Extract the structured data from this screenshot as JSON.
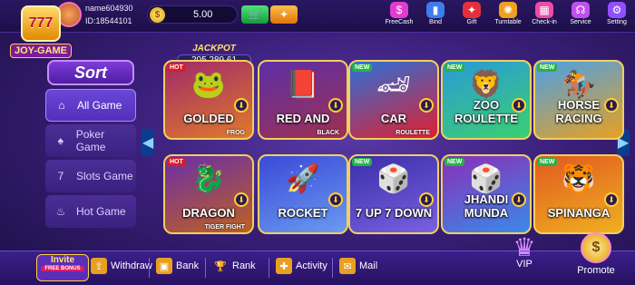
{
  "logo": {
    "badge": "777",
    "text": "JOY-GAME"
  },
  "user": {
    "name": "name604930",
    "id": "ID:18544101"
  },
  "balance": {
    "amount": "5.00"
  },
  "top_nav": [
    {
      "label": "FreeCash",
      "icon": "cash-icon",
      "color": "#e23bd0",
      "glyph": "$"
    },
    {
      "label": "Bind",
      "icon": "phone-icon",
      "color": "#3a7ef0",
      "glyph": "▮"
    },
    {
      "label": "Gift",
      "icon": "gift-icon",
      "color": "#e2313b",
      "glyph": "✦"
    },
    {
      "label": "Turntable",
      "icon": "wheel-icon",
      "color": "#f0a020",
      "glyph": "✺"
    },
    {
      "label": "Check-in",
      "icon": "calendar-icon",
      "color": "#ef4aa8",
      "glyph": "▦"
    },
    {
      "label": "Service",
      "icon": "headset-icon",
      "color": "#c050ee",
      "glyph": "☊"
    },
    {
      "label": "Setting",
      "icon": "gear-icon",
      "color": "#9050ff",
      "glyph": "⚙"
    }
  ],
  "sort_label": "Sort",
  "categories": [
    {
      "label": "All Game",
      "glyph": "⌂",
      "icon": "home-icon"
    },
    {
      "label": "Poker Game",
      "glyph": "♠",
      "icon": "poker-icon"
    },
    {
      "label": "Slots Game",
      "glyph": "7",
      "icon": "slots-icon"
    },
    {
      "label": "Hot Game",
      "glyph": "♨",
      "icon": "hot-icon"
    }
  ],
  "jackpot": {
    "title": "JACKPOT",
    "value": "205,289.61"
  },
  "games": [
    {
      "name": "GOLDED",
      "sub": "FROG",
      "tag": "HOT",
      "glyph": "🐸",
      "bg": "#a02a6a",
      "bg2": "#e07a2a"
    },
    {
      "name": "RED AND",
      "sub": "BLACK",
      "tag": "",
      "glyph": "📕",
      "bg": "#5b2fa8",
      "bg2": "#a03050"
    },
    {
      "name": "CAR",
      "sub": "ROULETTE",
      "tag": "NEW",
      "glyph": "🏎",
      "bg": "#2a70d8",
      "bg2": "#e02030"
    },
    {
      "name": "ZOO ROULETTE",
      "sub": "",
      "tag": "NEW",
      "glyph": "🦁",
      "bg": "#2a9ad8",
      "bg2": "#3ad070"
    },
    {
      "name": "HORSE RACING",
      "sub": "",
      "tag": "NEW",
      "glyph": "🏇",
      "bg": "#4aa0e8",
      "bg2": "#e8a020"
    },
    {
      "name": "DRAGON",
      "sub": "TIGER FIGHT",
      "tag": "HOT",
      "glyph": "🐉",
      "bg": "#6a2fa8",
      "bg2": "#c06020"
    },
    {
      "name": "ROCKET",
      "sub": "",
      "tag": "",
      "glyph": "🚀",
      "bg": "#3a4ad8",
      "bg2": "#6a9af0"
    },
    {
      "name": "7 UP 7 DOWN",
      "sub": "",
      "tag": "NEW",
      "glyph": "🎲",
      "bg": "#3a2fa8",
      "bg2": "#7a60e0"
    },
    {
      "name": "JHANDI MUNDA",
      "sub": "",
      "tag": "NEW",
      "glyph": "🎲",
      "bg": "#8a2fb8",
      "bg2": "#3a8ae8"
    },
    {
      "name": "SPINANGA",
      "sub": "",
      "tag": "NEW",
      "glyph": "🐯",
      "bg": "#e05a20",
      "bg2": "#f0b020"
    }
  ],
  "bottom": {
    "invite_title": "Invite",
    "invite_sub": "FREE BONUS",
    "withdraw": "Withdraw",
    "bank": "Bank",
    "rank": "Rank",
    "activity": "Activity",
    "mail": "Mail",
    "vip": "VIP",
    "promote": "Promote"
  }
}
